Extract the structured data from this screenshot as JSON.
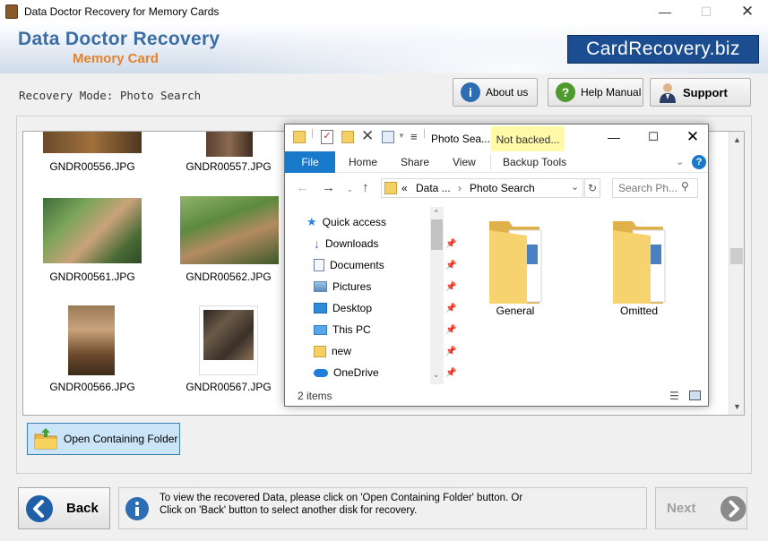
{
  "window": {
    "title": "Data Doctor Recovery for Memory Cards"
  },
  "banner": {
    "title": "Data Doctor Recovery",
    "subtitle": "Memory Card",
    "site": "CardRecovery.biz"
  },
  "mode_label": "Recovery Mode: Photo Search",
  "top_buttons": {
    "about": "About us",
    "help": "Help Manual",
    "support": "Support"
  },
  "gallery": {
    "items": [
      {
        "name": "GNDR00556.JPG"
      },
      {
        "name": "GNDR00557.JPG"
      },
      {
        "name": "GNDR00561.JPG"
      },
      {
        "name": "GNDR00562.JPG"
      },
      {
        "name": "GNDR00566.JPG"
      },
      {
        "name": "GNDR00567.JPG"
      }
    ]
  },
  "open_folder_label": "Open Containing Folder",
  "explorer": {
    "title": "Photo Sea...",
    "status_badge": "Not backed...",
    "tabs": [
      "File",
      "Home",
      "Share",
      "View",
      "Backup Tools"
    ],
    "address": {
      "prefix": "«",
      "crumb1": "Data ...",
      "sep": "›",
      "crumb2": "Photo Search"
    },
    "search_placeholder": "Search Ph...",
    "nav": [
      "Quick access",
      "Downloads",
      "Documents",
      "Pictures",
      "Desktop",
      "This PC",
      "new",
      "OneDrive"
    ],
    "folders": [
      "General",
      "Omitted"
    ],
    "item_count": "2 items"
  },
  "footer": {
    "back": "Back",
    "next": "Next",
    "info_line1": "To view the recovered Data, please click on 'Open Containing Folder' button. Or",
    "info_line2": "Click on 'Back' button to select another disk for recovery."
  },
  "colors": {
    "brand_blue": "#3a6ea5",
    "brand_orange": "#e8822a",
    "site_badge": "#1c4d91",
    "explorer_file_tab": "#1979ca"
  }
}
